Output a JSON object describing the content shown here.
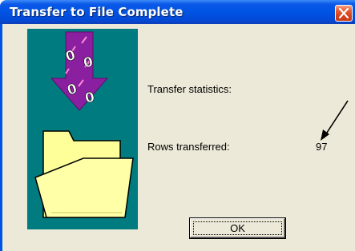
{
  "window": {
    "title": "Transfer to File Complete"
  },
  "icons": {
    "close": "close-icon",
    "graphic": "file-transfer-illustration",
    "annotation": "annotation-arrow"
  },
  "content": {
    "stats_title": "Transfer statistics:",
    "rows_label": "Rows transferred:",
    "rows_value": "97"
  },
  "buttons": {
    "ok_label": "OK"
  },
  "colors": {
    "title_bar": "#0054e3",
    "close_button": "#e65a2f",
    "dialog_background": "#ece9d8",
    "graphic_background": "#007c80",
    "arrow_purple": "#8a1fa0",
    "folder_yellow": "#ffff99"
  }
}
